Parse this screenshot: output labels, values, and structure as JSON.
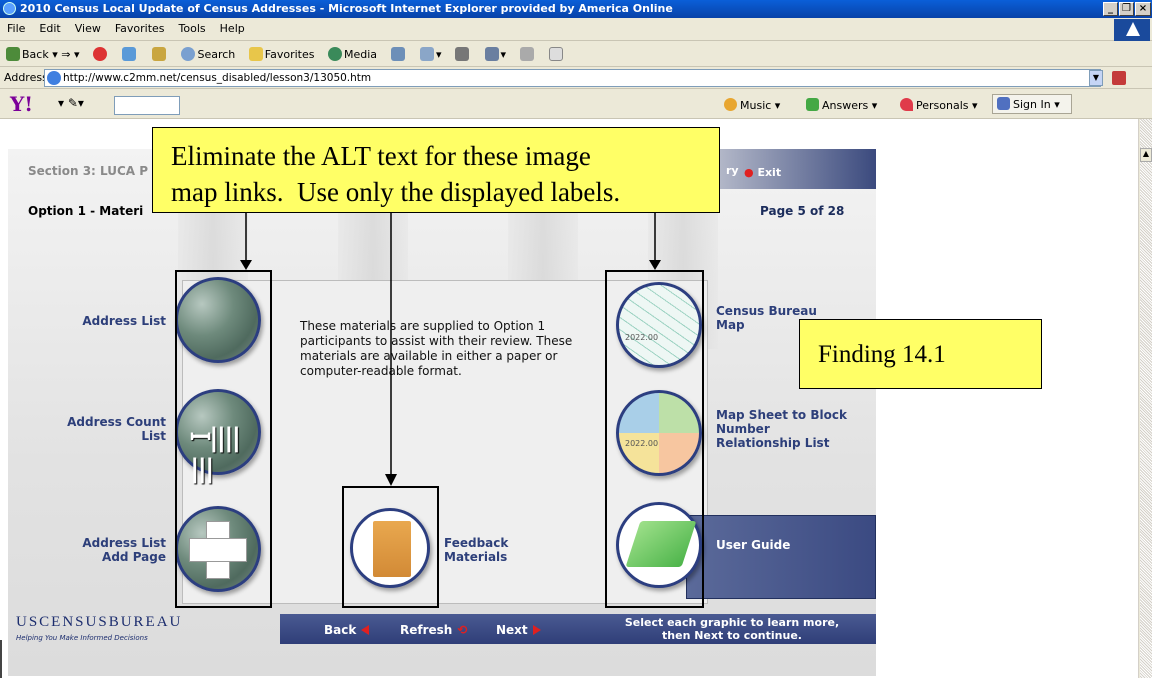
{
  "window": {
    "title": "2010 Census Local Update of Census Addresses - Microsoft Internet Explorer provided by America Online",
    "buttons": [
      "_",
      "×"
    ]
  },
  "menu": [
    "File",
    "Edit",
    "View",
    "Favorites",
    "Tools",
    "Help"
  ],
  "toolbar": {
    "back": "Back",
    "search": "Search",
    "favorites": "Favorites",
    "media": "Media"
  },
  "address": {
    "label": "Address",
    "url": "http://www.c2mm.net/census_disabled/lesson3/13050.htm"
  },
  "yahoo": {
    "logo": "Y!",
    "music": "Music",
    "answers": "Answers",
    "personals": "Personals",
    "signin": "Sign In"
  },
  "page": {
    "section_title": "Section 3: LUCA P",
    "option_title": "Option 1 - Materi",
    "page_number": "Page 5 of 28",
    "exit_label": "Exit",
    "ry_label": "ry",
    "description": "These materials are supplied to Option 1 participants to assist with their review. These materials are available in either a paper or computer-readable format.",
    "left_items": [
      {
        "label_l1": "Address List",
        "label_l2": ""
      },
      {
        "label_l1": "Address Count",
        "label_l2": "List"
      },
      {
        "label_l1": "Address List",
        "label_l2": "Add Page"
      }
    ],
    "feedback": {
      "l1": "Feedback",
      "l2": "Materials"
    },
    "right_items": [
      {
        "l1": "Census Bureau",
        "l2": "Map",
        "l3": ""
      },
      {
        "l1": "Map Sheet to Block",
        "l2": "Number",
        "l3": "Relationship List"
      },
      {
        "l1": "User Guide",
        "l2": "",
        "l3": ""
      }
    ],
    "map_number": "2022.00",
    "logo": "USCENSUSBUREAU",
    "tagline": "Helping You Make Informed Decisions",
    "nav": {
      "back": "Back",
      "refresh": "Refresh",
      "next": "Next",
      "instruction_l1": "Select each graphic to learn more,",
      "instruction_l2": "then Next to continue."
    }
  },
  "annotations": {
    "callout_l1": "Eliminate the ALT text for these image",
    "callout_l2": "map links.  Use only the displayed labels.",
    "finding": "Finding 14.1"
  }
}
